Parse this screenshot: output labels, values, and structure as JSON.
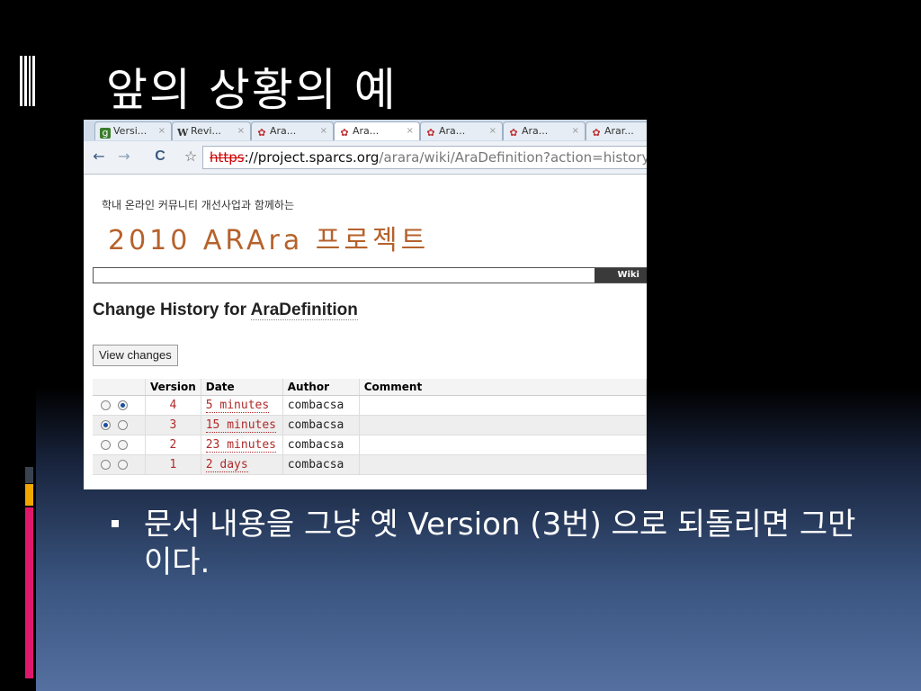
{
  "slide": {
    "title": "앞의 상황의 예",
    "bullet": "문서 내용을 그냥 옛 Version (3번) 으로 되돌리면 그만이다."
  },
  "browser": {
    "tabs": [
      {
        "icon": "google-icon",
        "label": "Versi..."
      },
      {
        "icon": "wikipedia-icon",
        "label": "Revi..."
      },
      {
        "icon": "paw-icon",
        "label": "Ara..."
      },
      {
        "icon": "paw-icon",
        "label": "Ara...",
        "active": true
      },
      {
        "icon": "paw-icon",
        "label": "Ara..."
      },
      {
        "icon": "paw-icon",
        "label": "Ara..."
      },
      {
        "icon": "paw-icon",
        "label": "Arar..."
      }
    ],
    "tab_close": "×",
    "url": {
      "scheme": "https",
      "host": "://project.sparcs.org",
      "path": "/arara/wiki/AraDefinition?action=history"
    },
    "nav": {
      "back": "←",
      "forward": "→",
      "reload": "C",
      "star": "☆"
    }
  },
  "page": {
    "tagline": "학내 온라인 커뮤니티 개선사업과 함께하는",
    "logo": "2010 ARAra 프로젝트",
    "wiki_tab": "Wiki",
    "heading_prefix": "Change History for ",
    "heading_link": "AraDefinition",
    "view_changes": "View changes",
    "columns": [
      "Version",
      "Date",
      "Author",
      "Comment"
    ],
    "rows": [
      {
        "version": "4",
        "date": "5 minutes",
        "author": "combacsa",
        "comment": ""
      },
      {
        "version": "3",
        "date": "15 minutes",
        "author": "combacsa",
        "comment": ""
      },
      {
        "version": "2",
        "date": "23 minutes",
        "author": "combacsa",
        "comment": ""
      },
      {
        "version": "1",
        "date": "2 days",
        "author": "combacsa",
        "comment": ""
      }
    ]
  },
  "colors": {
    "accent_red": "#b02a2a",
    "logo_orange": "#b5622c",
    "slide_accent_1": "#2f3a48",
    "slide_accent_2": "#f0a800",
    "slide_accent_3": "#e0186c"
  }
}
